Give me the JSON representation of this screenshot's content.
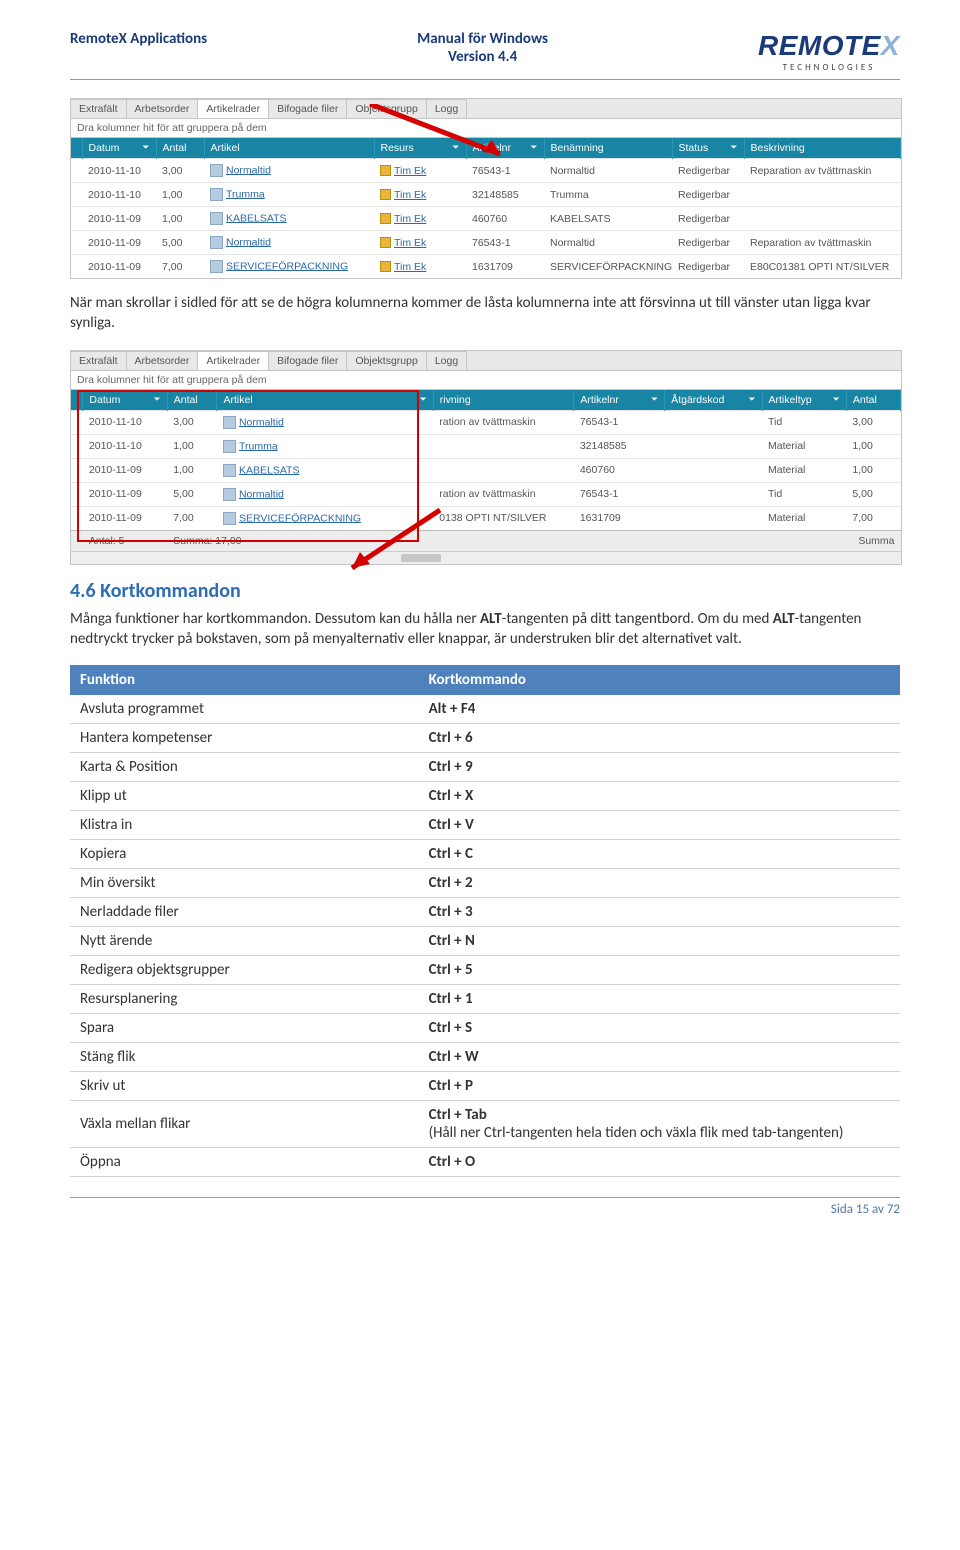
{
  "header": {
    "left": "RemoteX Applications",
    "center_line1": "Manual för Windows",
    "center_line2": "Version 4.4",
    "logo_text": "REMOTE",
    "logo_suffix": "X",
    "logo_sub": "TECHNOLOGIES"
  },
  "screenshot1": {
    "tabs": [
      "Extrafält",
      "Arbetsorder",
      "Artikelrader",
      "Bifogade filer",
      "Objektsgrupp",
      "Logg"
    ],
    "active_tab": 2,
    "group_text": "Dra kolumner hit för att gruppera på dem",
    "headers": [
      "Datum",
      "Antal",
      "Artikel",
      "Resurs",
      "Artikelnr",
      "Benämning",
      "Status",
      "Beskrivning"
    ],
    "filter_cols": [
      0,
      3,
      4,
      6
    ],
    "rows": [
      {
        "Datum": "2010-11-10",
        "Antal": "3,00",
        "Artikel": "Normaltid",
        "Resurs": "Tim Ek",
        "Artikelnr": "76543-1",
        "Benämning": "Normaltid",
        "Status": "Redigerbar",
        "Beskrivning": "Reparation av tvättmaskin"
      },
      {
        "Datum": "2010-11-10",
        "Antal": "1,00",
        "Artikel": "Trumma",
        "Resurs": "Tim Ek",
        "Artikelnr": "32148585",
        "Benämning": "Trumma",
        "Status": "Redigerbar",
        "Beskrivning": ""
      },
      {
        "Datum": "2010-11-09",
        "Antal": "1,00",
        "Artikel": "KABELSATS",
        "Resurs": "Tim Ek",
        "Artikelnr": "460760",
        "Benämning": "KABELSATS",
        "Status": "Redigerbar",
        "Beskrivning": ""
      },
      {
        "Datum": "2010-11-09",
        "Antal": "5,00",
        "Artikel": "Normaltid",
        "Resurs": "Tim Ek",
        "Artikelnr": "76543-1",
        "Benämning": "Normaltid",
        "Status": "Redigerbar",
        "Beskrivning": "Reparation av tvättmaskin"
      },
      {
        "Datum": "2010-11-09",
        "Antal": "7,00",
        "Artikel": "SERVICEFÖRPACKNING",
        "Resurs": "Tim Ek",
        "Artikelnr": "1631709",
        "Benämning": "SERVICEFÖRPACKNING",
        "Status": "Redigerbar",
        "Beskrivning": "E80C01381 OPTI NT/SILVER"
      }
    ]
  },
  "paragraph1": "När man skrollar i sidled för att se de högra kolumnerna kommer de låsta kolumnerna inte att försvinna ut till vänster utan ligga kvar synliga.",
  "screenshot2": {
    "tabs": [
      "Extrafält",
      "Arbetsorder",
      "Artikelrader",
      "Bifogade filer",
      "Objektsgrupp",
      "Logg"
    ],
    "active_tab": 2,
    "group_text": "Dra kolumner hit för att gruppera på dem",
    "headers_left": [
      "Datum",
      "Antal",
      "Artikel"
    ],
    "headers_right": [
      "rivning",
      "Artikelnr",
      "Åtgärdskod",
      "Artikeltyp",
      "Antal"
    ],
    "filter_cols_left": [
      0,
      2
    ],
    "filter_cols_right": [
      1,
      2,
      3
    ],
    "rows": [
      {
        "Datum": "2010-11-10",
        "Antal": "3,00",
        "Artikel": "Normaltid",
        "rivning": "ration av tvättmaskin",
        "Artikelnr": "76543-1",
        "Åtgärdskod": "",
        "Artikeltyp": "Tid",
        "AntalR": "3,00"
      },
      {
        "Datum": "2010-11-10",
        "Antal": "1,00",
        "Artikel": "Trumma",
        "rivning": "",
        "Artikelnr": "32148585",
        "Åtgärdskod": "",
        "Artikeltyp": "Material",
        "AntalR": "1,00"
      },
      {
        "Datum": "2010-11-09",
        "Antal": "1,00",
        "Artikel": "KABELSATS",
        "rivning": "",
        "Artikelnr": "460760",
        "Åtgärdskod": "",
        "Artikeltyp": "Material",
        "AntalR": "1,00"
      },
      {
        "Datum": "2010-11-09",
        "Antal": "5,00",
        "Artikel": "Normaltid",
        "rivning": "ration av tvättmaskin",
        "Artikelnr": "76543-1",
        "Åtgärdskod": "",
        "Artikeltyp": "Tid",
        "AntalR": "5,00"
      },
      {
        "Datum": "2010-11-09",
        "Antal": "7,00",
        "Artikel": "SERVICEFÖRPACKNING",
        "rivning": "0138 OPTI NT/SILVER",
        "Artikelnr": "1631709",
        "Åtgärdskod": "",
        "Artikeltyp": "Material",
        "AntalR": "7,00"
      }
    ],
    "footer_left": "Antal: 5",
    "footer_sum": "Summa: 17,00",
    "footer_right": "Summa"
  },
  "section_heading": "4.6   Kortkommandon",
  "paragraph2_a": "Många funktioner har kortkommandon. Dessutom kan du hålla ner ",
  "paragraph2_b": "ALT",
  "paragraph2_c": "-tangenten på ditt tangentbord. Om du med ",
  "paragraph2_d": "ALT",
  "paragraph2_e": "-tangenten nedtryckt trycker på bokstaven, som på menyalternativ eller knappar, är understruken blir det alternativet valt.",
  "shortcut_table": {
    "head": [
      "Funktion",
      "Kortkommando"
    ],
    "rows": [
      [
        "Avsluta programmet",
        "Alt + F4"
      ],
      [
        "Hantera kompetenser",
        "Ctrl + 6"
      ],
      [
        "Karta & Position",
        "Ctrl + 9"
      ],
      [
        "Klipp ut",
        "Ctrl + X"
      ],
      [
        "Klistra in",
        "Ctrl + V"
      ],
      [
        "Kopiera",
        "Ctrl + C"
      ],
      [
        "Min översikt",
        "Ctrl + 2"
      ],
      [
        "Nerladdade filer",
        "Ctrl + 3"
      ],
      [
        "Nytt ärende",
        "Ctrl + N"
      ],
      [
        "Redigera objektsgrupper",
        "Ctrl + 5"
      ],
      [
        "Resursplanering",
        "Ctrl + 1"
      ],
      [
        "Spara",
        "Ctrl + S"
      ],
      [
        "Stäng flik",
        "Ctrl + W"
      ],
      [
        "Skriv ut",
        "Ctrl + P"
      ],
      [
        "Växla mellan flikar",
        "Ctrl + Tab\n(Håll ner Ctrl-tangenten hela tiden och växla flik med tab-tangenten)"
      ],
      [
        "Öppna",
        "Ctrl + O"
      ]
    ]
  },
  "page_num": "Sida 15 av 72"
}
